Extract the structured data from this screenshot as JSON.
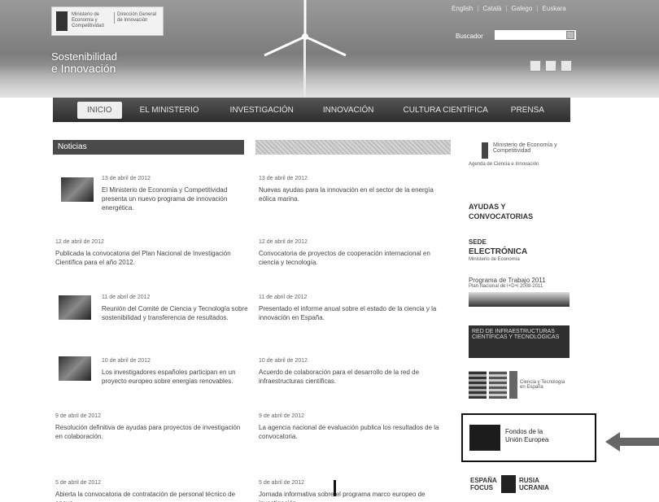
{
  "header": {
    "logo": {
      "ministry_line": "Ministerio de Economía y Competitividad",
      "org_line": "Dirección General de Innovación"
    },
    "site_title_line1": "Sostenibilidad",
    "site_title_line2": "e Innovación",
    "top_links": [
      "English",
      "Català",
      "Galego",
      "Euskara"
    ],
    "search": {
      "label": "Buscador",
      "placeholder": ""
    }
  },
  "nav": {
    "items": [
      "Inicio",
      "El Ministerio",
      "Investigación",
      "Innovación",
      "Cultura Científica",
      "Prensa"
    ]
  },
  "columns": {
    "left_heading": "Noticias",
    "right_heading": ""
  },
  "news_left": [
    {
      "date": "13 de abril de 2012",
      "text": "El Ministerio de Economía y Competitividad presenta un nuevo programa de innovación energética."
    },
    {
      "date": "12 de abril de 2012",
      "text": "Publicada la convocatoria del Plan Nacional de Investigación Científica para el año 2012."
    },
    {
      "date": "11 de abril de 2012",
      "text": "Reunión del Comité de Ciencia y Tecnología sobre sostenibilidad y transferencia de resultados."
    },
    {
      "date": "10 de abril de 2012",
      "text": "Los investigadores españoles participan en un proyecto europeo sobre energías renovables."
    },
    {
      "date": "9 de abril de 2012",
      "text": "Resolución definitiva de ayudas para proyectos de investigación en colaboración."
    },
    {
      "date": "5 de abril de 2012",
      "text": "Abierta la convocatoria de contratación de personal técnico de apoyo."
    }
  ],
  "news_right": [
    {
      "date": "13 de abril de 2012",
      "text": "Nuevas ayudas para la innovación en el sector de la energía eólica marina."
    },
    {
      "date": "12 de abril de 2012",
      "text": "Convocatoria de proyectos de cooperación internacional en ciencia y tecnología."
    },
    {
      "date": "11 de abril de 2012",
      "text": "Presentado el informe anual sobre el estado de la ciencia y la innovación en España."
    },
    {
      "date": "10 de abril de 2012",
      "text": "Acuerdo de colaboración para el desarrollo de la red de infraestructuras científicas."
    },
    {
      "date": "9 de abril de 2012",
      "text": "La agencia nacional de evaluación publica los resultados de la convocatoria."
    },
    {
      "date": "5 de abril de 2012",
      "text": "Jornada informativa sobre el programa marco europeo de investigación."
    }
  ],
  "sidebar": {
    "ministry_short": "Ministerio de Economía y Competitividad",
    "ministry_link": "Agenda de Ciencia e Innovación",
    "ayudas": "AYUDAS Y CONVOCATORIAS",
    "sede_1": "SEDE",
    "sede_2": "ELECTRÓNICA",
    "sede_small": "Ministerio de Economía",
    "programa": "Programa de Trabajo 2011",
    "programa_sub": "Plan Nacional de I+D+i 2008-2011",
    "banner_text": "RED DE INFRAESTRUCTURAS CIENTÍFICAS Y TECNOLÓGICAS",
    "books_text": "Ciencia y Tecnología en España",
    "eu_line1": "Fondos de la",
    "eu_line2": "Unión Europea",
    "bottom_logo_left": "ESPAÑA FOCUS",
    "bottom_logo_right": "RUSIA UCRANIA"
  }
}
